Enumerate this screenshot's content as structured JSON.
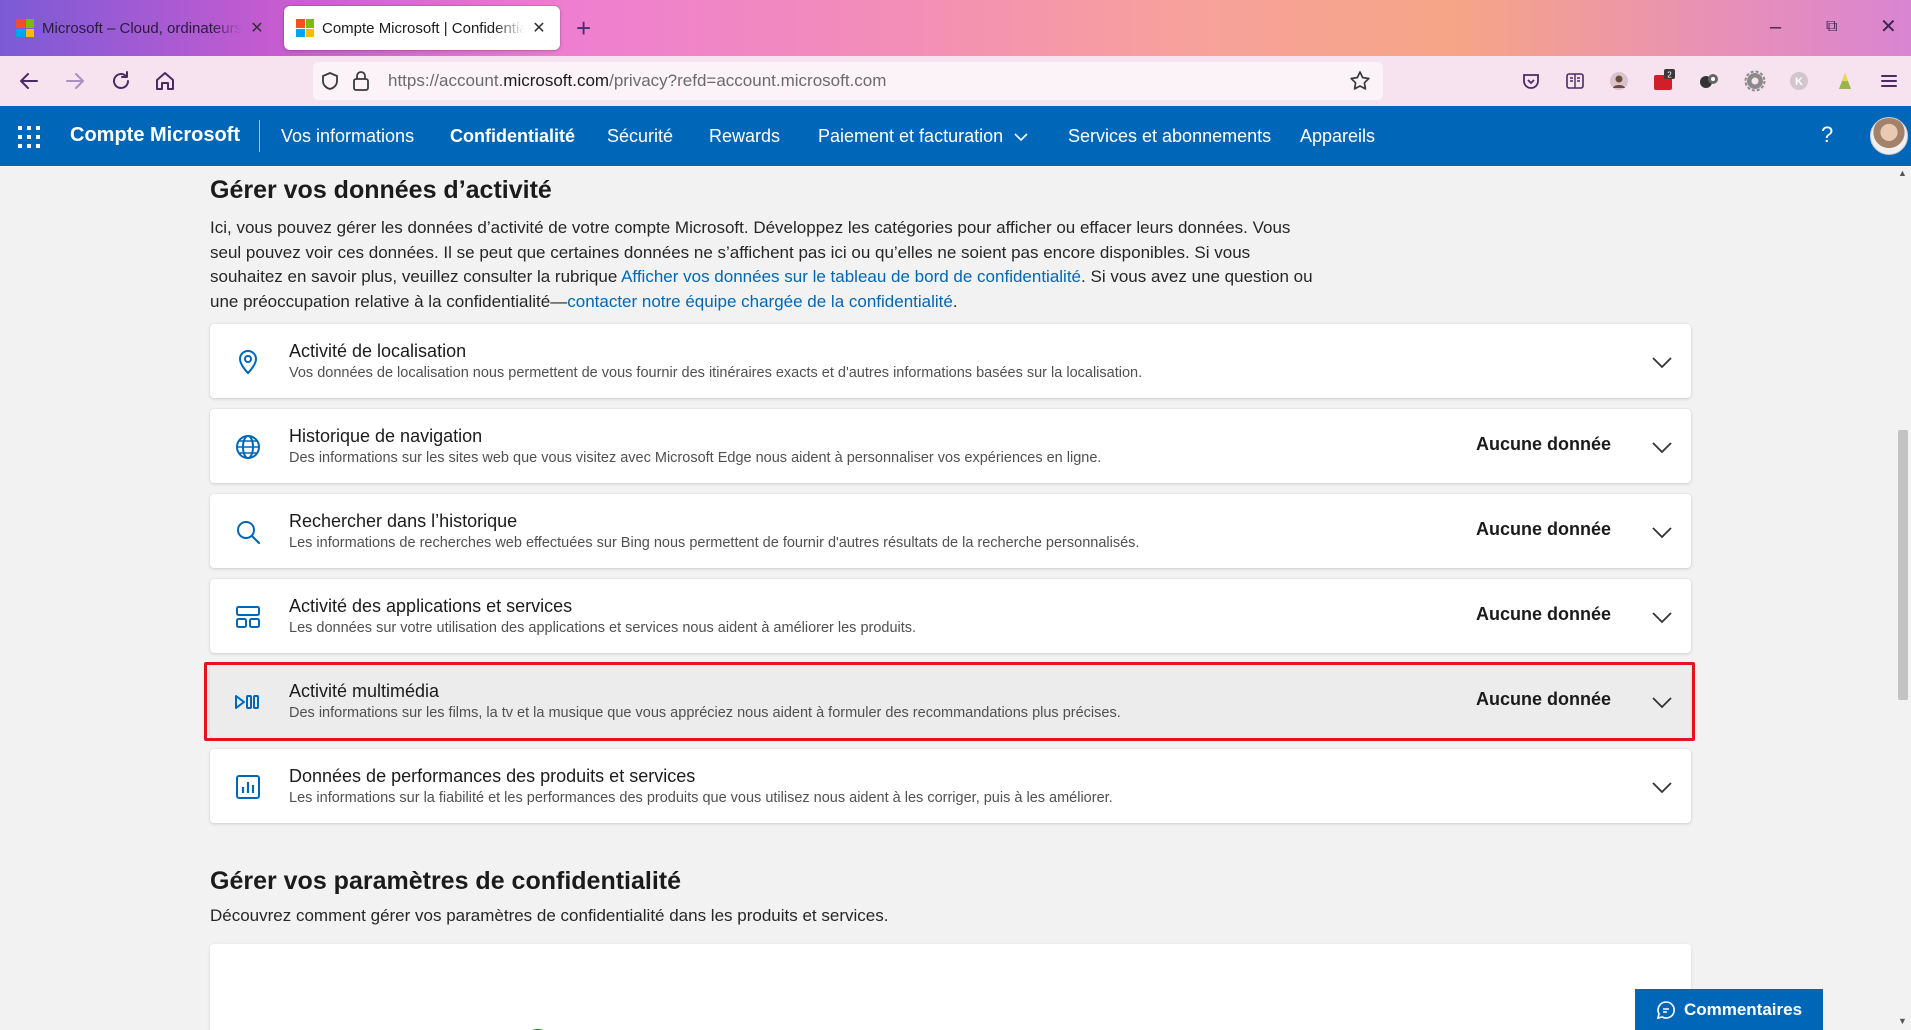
{
  "browser": {
    "tabs": [
      {
        "title": "Microsoft – Cloud, ordinateurs, Apps & Gaming",
        "active": false
      },
      {
        "title": "Compte Microsoft | Confidentialité",
        "active": true
      }
    ],
    "new_tab": "+",
    "url": {
      "prefix": "https://account.",
      "domain": "microsoft.com",
      "path": "/privacy?refd=account.microsoft.com"
    },
    "extension_badge": "2",
    "extension_letter": "K"
  },
  "header": {
    "brand": "Compte Microsoft",
    "nav": [
      {
        "label": "Vos informations",
        "active": false
      },
      {
        "label": "Confidentialité",
        "active": true
      },
      {
        "label": "Sécurité",
        "active": false
      },
      {
        "label": "Rewards",
        "active": false
      },
      {
        "label": "Paiement et facturation",
        "active": false,
        "dropdown": true
      },
      {
        "label": "Services et abonnements",
        "active": false
      },
      {
        "label": "Appareils",
        "active": false
      }
    ],
    "help": "?"
  },
  "activity": {
    "title": "Gérer vos données d’activité",
    "intro_1": "Ici, vous pouvez gérer les données d’activité de votre compte Microsoft. Développez les catégories pour afficher ou effacer leurs données. Vous seul pouvez voir ces données. Il se peut que certaines données ne s’affichent pas ici ou qu’elles ne soient pas encore disponibles. Si vous souhaitez en savoir plus, veuillez consulter la rubrique ",
    "intro_link_1": "Afficher vos données sur le tableau de bord de confidentialité",
    "intro_2": ". Si vous avez une question ou une préoccupation relative à la confidentialité—",
    "intro_link_2": "contacter notre équipe chargée de la confidentialité",
    "intro_3": ".",
    "categories": [
      {
        "icon": "location-pin-icon",
        "title": "Activité de localisation",
        "description": "Vos données de localisation nous permettent de vous fournir des itinéraires exacts et d'autres informations basées sur la localisation.",
        "status": ""
      },
      {
        "icon": "globe-icon",
        "title": "Historique de navigation",
        "description": "Des informations sur les sites web que vous visitez avec Microsoft Edge nous aident à personnaliser vos expériences en ligne.",
        "status": "Aucune donnée"
      },
      {
        "icon": "search-icon",
        "title": "Rechercher dans l’historique",
        "description": "Les informations de recherches web effectuées sur Bing nous permettent de fournir d'autres résultats de la recherche personnalisés.",
        "status": "Aucune donnée"
      },
      {
        "icon": "apps-services-icon",
        "title": "Activité des applications et services",
        "description": "Les données sur votre utilisation des applications et services nous aident à améliorer les produits.",
        "status": "Aucune donnée"
      },
      {
        "icon": "media-play-icon",
        "title": "Activité multimédia",
        "description": "Des informations sur les films, la tv et la musique que vous appréciez nous aident à formuler des recommandations plus précises.",
        "status": "Aucune donnée",
        "highlighted": true
      },
      {
        "icon": "performance-chart-icon",
        "title": "Données de performances des produits et services",
        "description": "Les informations sur la fiabilité et les performances des produits que vous utilisez nous aident à les corriger, puis à les améliorer.",
        "status": ""
      }
    ]
  },
  "settings": {
    "title": "Gérer vos paramètres de confidentialité",
    "intro": "Découvrez comment gérer vos paramètres de confidentialité dans les produits et services."
  },
  "feedback": {
    "label": "Commentaires"
  },
  "colors": {
    "brand_blue": "#0067b8",
    "highlight_border": "#e81123"
  }
}
